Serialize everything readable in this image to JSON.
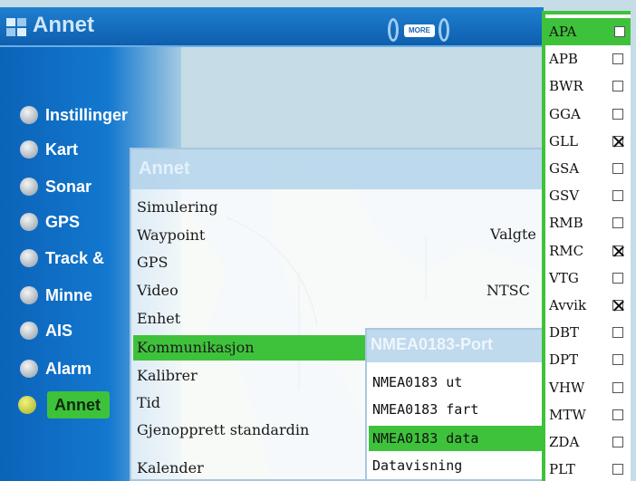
{
  "window": {
    "title": "Annet",
    "more_label": "MORE"
  },
  "sidebar": {
    "items": [
      {
        "label": "Instillinger",
        "icon": "settings-icon"
      },
      {
        "label": "Kart",
        "icon": "chart-icon"
      },
      {
        "label": "Sonar",
        "icon": "sonar-icon"
      },
      {
        "label": "GPS",
        "icon": "gps-icon"
      },
      {
        "label": "Track &",
        "icon": "track-icon"
      },
      {
        "label": "Minne",
        "icon": "memory-icon"
      },
      {
        "label": "AIS",
        "icon": "ais-icon"
      },
      {
        "label": "Alarm",
        "icon": "alarm-icon"
      },
      {
        "label": "Annet",
        "icon": "other-icon",
        "active": true
      }
    ]
  },
  "submenu": {
    "title": "Annet",
    "items": [
      "Simulering",
      "Waypoint",
      "GPS",
      "Video",
      "Enhet",
      "Kommunikasjon",
      "Kalibrer",
      "Tid",
      "Gjenopprett standardin",
      "Kalender"
    ],
    "selected": "Kommunikasjon",
    "values": {
      "waypoint": "Valgte",
      "video": "NTSC"
    }
  },
  "port_panel": {
    "title": "NMEA0183-Port",
    "items": [
      "NMEA0183 ut",
      "NMEA0183 fart",
      "NMEA0183 data",
      "Datavisning"
    ],
    "selected": "NMEA0183 data"
  },
  "sentences": [
    {
      "label": "APA",
      "checked": false,
      "selected": true
    },
    {
      "label": "APB",
      "checked": false
    },
    {
      "label": "BWR",
      "checked": false
    },
    {
      "label": "GGA",
      "checked": false
    },
    {
      "label": "GLL",
      "checked": true
    },
    {
      "label": "GSA",
      "checked": false
    },
    {
      "label": "GSV",
      "checked": false
    },
    {
      "label": "RMB",
      "checked": false
    },
    {
      "label": "RMC",
      "checked": true
    },
    {
      "label": "VTG",
      "checked": false
    },
    {
      "label": "Avvik",
      "checked": true
    },
    {
      "label": "DBT",
      "checked": false
    },
    {
      "label": "DPT",
      "checked": false
    },
    {
      "label": "VHW",
      "checked": false
    },
    {
      "label": "MTW",
      "checked": false
    },
    {
      "label": "ZDA",
      "checked": false
    },
    {
      "label": "PLT",
      "checked": false
    }
  ],
  "colors": {
    "accent_green": "#3fc23b",
    "header_blue": "#1477cf"
  }
}
